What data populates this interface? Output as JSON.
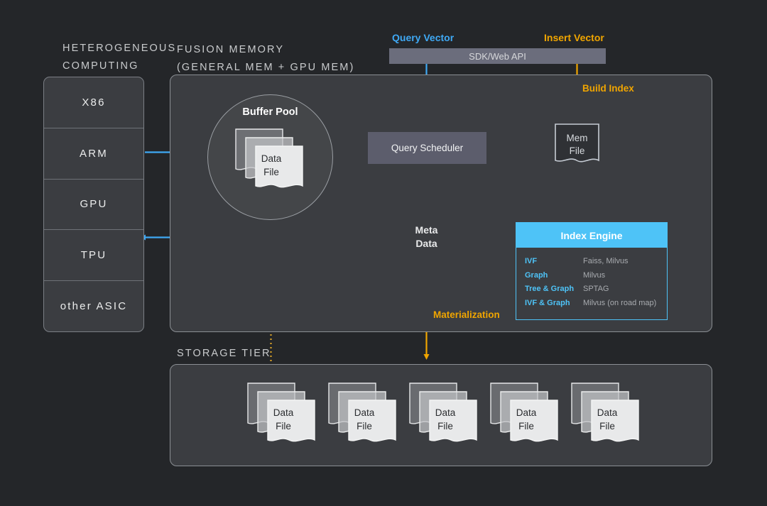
{
  "sections": {
    "heterogeneous_computing": "HETEROGENEOUS\nCOMPUTING",
    "fusion_memory": "FUSION MEMORY\n(GENERAL MEM + GPU MEM)",
    "storage_tier": "STORAGE TIER"
  },
  "hetero": {
    "items": [
      "X86",
      "ARM",
      "GPU",
      "TPU",
      "other ASIC"
    ]
  },
  "api": {
    "bar_label": "SDK/Web API",
    "query_vector": "Query Vector",
    "insert_vector": "Insert Vector"
  },
  "flows": {
    "build_index": "Build Index",
    "materialization": "Materialization"
  },
  "buffer_pool": {
    "title": "Buffer Pool",
    "file_label": "Data\nFile"
  },
  "query_scheduler": {
    "label": "Query Scheduler"
  },
  "meta_data": {
    "label": "Meta\nData"
  },
  "mem_file": {
    "label": "Mem\nFile"
  },
  "index_engine": {
    "title": "Index Engine",
    "rows": [
      {
        "type": "IVF",
        "impl": "Faiss, Milvus"
      },
      {
        "type": "Graph",
        "impl": "Milvus"
      },
      {
        "type": "Tree & Graph",
        "impl": "SPTAG"
      },
      {
        "type": "IVF & Graph",
        "impl": "Milvus (on road map)"
      }
    ]
  },
  "storage": {
    "files": [
      {
        "label": "Data\nFile"
      },
      {
        "label": "Data\nFile"
      },
      {
        "label": "Data\nFile"
      },
      {
        "label": "Data\nFile"
      },
      {
        "label": "Data\nFile"
      }
    ]
  },
  "colors": {
    "background": "#242629",
    "panel": "#3b3d41",
    "panel_border": "#8b8f94",
    "accent_blue": "#3fa9f5",
    "accent_cyan": "#4ec3f7",
    "accent_orange": "#f0a500",
    "text_primary": "#e8e9ea",
    "text_muted": "#a8abaf",
    "scheduler_fill": "#5c5d6c",
    "sdk_fill": "#6b6d7c"
  }
}
